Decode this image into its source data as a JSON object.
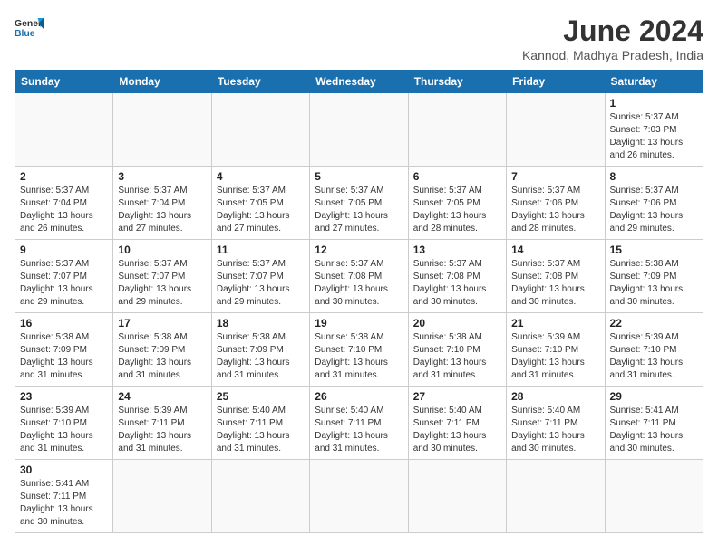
{
  "header": {
    "logo_general": "General",
    "logo_blue": "Blue",
    "month_title": "June 2024",
    "subtitle": "Kannod, Madhya Pradesh, India"
  },
  "days_of_week": [
    "Sunday",
    "Monday",
    "Tuesday",
    "Wednesday",
    "Thursday",
    "Friday",
    "Saturday"
  ],
  "weeks": [
    [
      {
        "day": "",
        "info": ""
      },
      {
        "day": "",
        "info": ""
      },
      {
        "day": "",
        "info": ""
      },
      {
        "day": "",
        "info": ""
      },
      {
        "day": "",
        "info": ""
      },
      {
        "day": "",
        "info": ""
      },
      {
        "day": "1",
        "info": "Sunrise: 5:37 AM\nSunset: 7:03 PM\nDaylight: 13 hours and 26 minutes."
      }
    ],
    [
      {
        "day": "2",
        "info": "Sunrise: 5:37 AM\nSunset: 7:04 PM\nDaylight: 13 hours and 26 minutes."
      },
      {
        "day": "3",
        "info": "Sunrise: 5:37 AM\nSunset: 7:04 PM\nDaylight: 13 hours and 27 minutes."
      },
      {
        "day": "4",
        "info": "Sunrise: 5:37 AM\nSunset: 7:05 PM\nDaylight: 13 hours and 27 minutes."
      },
      {
        "day": "5",
        "info": "Sunrise: 5:37 AM\nSunset: 7:05 PM\nDaylight: 13 hours and 27 minutes."
      },
      {
        "day": "6",
        "info": "Sunrise: 5:37 AM\nSunset: 7:05 PM\nDaylight: 13 hours and 28 minutes."
      },
      {
        "day": "7",
        "info": "Sunrise: 5:37 AM\nSunset: 7:06 PM\nDaylight: 13 hours and 28 minutes."
      },
      {
        "day": "8",
        "info": "Sunrise: 5:37 AM\nSunset: 7:06 PM\nDaylight: 13 hours and 29 minutes."
      }
    ],
    [
      {
        "day": "9",
        "info": "Sunrise: 5:37 AM\nSunset: 7:07 PM\nDaylight: 13 hours and 29 minutes."
      },
      {
        "day": "10",
        "info": "Sunrise: 5:37 AM\nSunset: 7:07 PM\nDaylight: 13 hours and 29 minutes."
      },
      {
        "day": "11",
        "info": "Sunrise: 5:37 AM\nSunset: 7:07 PM\nDaylight: 13 hours and 29 minutes."
      },
      {
        "day": "12",
        "info": "Sunrise: 5:37 AM\nSunset: 7:08 PM\nDaylight: 13 hours and 30 minutes."
      },
      {
        "day": "13",
        "info": "Sunrise: 5:37 AM\nSunset: 7:08 PM\nDaylight: 13 hours and 30 minutes."
      },
      {
        "day": "14",
        "info": "Sunrise: 5:37 AM\nSunset: 7:08 PM\nDaylight: 13 hours and 30 minutes."
      },
      {
        "day": "15",
        "info": "Sunrise: 5:38 AM\nSunset: 7:09 PM\nDaylight: 13 hours and 30 minutes."
      }
    ],
    [
      {
        "day": "16",
        "info": "Sunrise: 5:38 AM\nSunset: 7:09 PM\nDaylight: 13 hours and 31 minutes."
      },
      {
        "day": "17",
        "info": "Sunrise: 5:38 AM\nSunset: 7:09 PM\nDaylight: 13 hours and 31 minutes."
      },
      {
        "day": "18",
        "info": "Sunrise: 5:38 AM\nSunset: 7:09 PM\nDaylight: 13 hours and 31 minutes."
      },
      {
        "day": "19",
        "info": "Sunrise: 5:38 AM\nSunset: 7:10 PM\nDaylight: 13 hours and 31 minutes."
      },
      {
        "day": "20",
        "info": "Sunrise: 5:38 AM\nSunset: 7:10 PM\nDaylight: 13 hours and 31 minutes."
      },
      {
        "day": "21",
        "info": "Sunrise: 5:39 AM\nSunset: 7:10 PM\nDaylight: 13 hours and 31 minutes."
      },
      {
        "day": "22",
        "info": "Sunrise: 5:39 AM\nSunset: 7:10 PM\nDaylight: 13 hours and 31 minutes."
      }
    ],
    [
      {
        "day": "23",
        "info": "Sunrise: 5:39 AM\nSunset: 7:10 PM\nDaylight: 13 hours and 31 minutes."
      },
      {
        "day": "24",
        "info": "Sunrise: 5:39 AM\nSunset: 7:11 PM\nDaylight: 13 hours and 31 minutes."
      },
      {
        "day": "25",
        "info": "Sunrise: 5:40 AM\nSunset: 7:11 PM\nDaylight: 13 hours and 31 minutes."
      },
      {
        "day": "26",
        "info": "Sunrise: 5:40 AM\nSunset: 7:11 PM\nDaylight: 13 hours and 31 minutes."
      },
      {
        "day": "27",
        "info": "Sunrise: 5:40 AM\nSunset: 7:11 PM\nDaylight: 13 hours and 30 minutes."
      },
      {
        "day": "28",
        "info": "Sunrise: 5:40 AM\nSunset: 7:11 PM\nDaylight: 13 hours and 30 minutes."
      },
      {
        "day": "29",
        "info": "Sunrise: 5:41 AM\nSunset: 7:11 PM\nDaylight: 13 hours and 30 minutes."
      }
    ],
    [
      {
        "day": "30",
        "info": "Sunrise: 5:41 AM\nSunset: 7:11 PM\nDaylight: 13 hours and 30 minutes."
      },
      {
        "day": "",
        "info": ""
      },
      {
        "day": "",
        "info": ""
      },
      {
        "day": "",
        "info": ""
      },
      {
        "day": "",
        "info": ""
      },
      {
        "day": "",
        "info": ""
      },
      {
        "day": "",
        "info": ""
      }
    ]
  ]
}
